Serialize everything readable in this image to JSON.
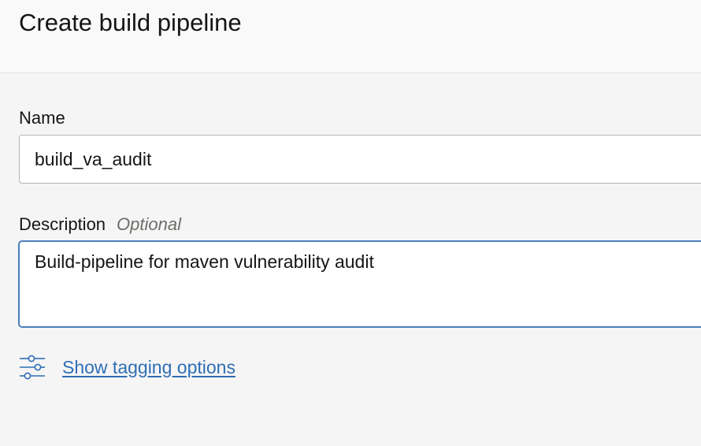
{
  "header": {
    "title": "Create build pipeline"
  },
  "form": {
    "name": {
      "label": "Name",
      "value": "build_va_audit"
    },
    "description": {
      "label": "Description",
      "optional_label": "Optional",
      "value": "Build-pipeline for maven vulnerability audit"
    },
    "tagging": {
      "icon": "sliders-icon",
      "link_label": "Show tagging options"
    }
  },
  "colors": {
    "link": "#2f6eb5",
    "focus_border": "#4a7fb8",
    "background": "#f5f5f5"
  }
}
